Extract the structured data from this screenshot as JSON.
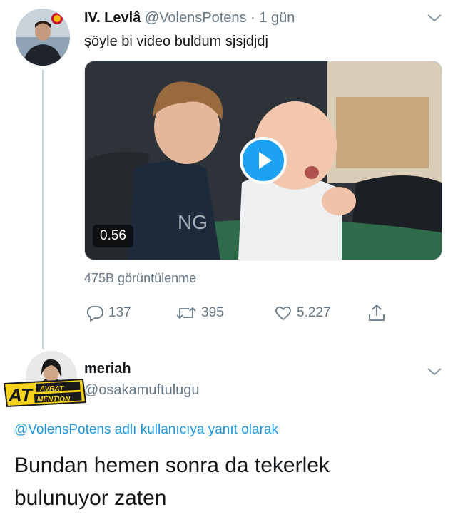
{
  "tweet": {
    "author_name": "IV. Levlâ",
    "handle": "@VolensPotens",
    "time": "· 1 gün",
    "text": "şöyle bi video buldum sjsjdjdj",
    "video_duration": "0.56",
    "views": "475B görüntülenme",
    "replies": "137",
    "retweets": "395",
    "likes": "5.227"
  },
  "reply": {
    "author_name": "meriah",
    "handle": "@osakamuftulugu",
    "replying_handle": "@VolensPotens",
    "replying_suffix": "adlı kullanıcıya yanıt olarak",
    "text_line1": "Bundan hemen sonra da tekerlek",
    "text_line2": "bulunuyor zaten"
  },
  "watermark": {
    "big": "AT",
    "top": "AVRAT",
    "bottom": "MENTION"
  },
  "colors": {
    "accent": "#1da1f2",
    "link": "#1b95e0",
    "muted": "#657786"
  }
}
